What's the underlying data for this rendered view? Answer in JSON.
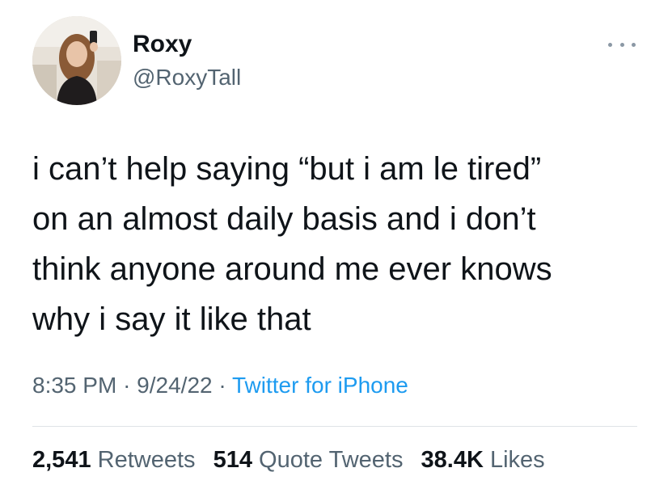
{
  "tweet": {
    "author": {
      "name": "Roxy",
      "handle": "@RoxyTall",
      "avatar_icon": "profile-photo"
    },
    "more_icon": "more-dots-icon",
    "text_lines": [
      "i can’t help saying “but i am le tired”",
      "on an almost daily basis and i don’t",
      "think anyone around me ever knows",
      "why i say it like that"
    ],
    "time": "8:35 PM",
    "date": "9/24/22",
    "separator": "·",
    "source": "Twitter for iPhone",
    "stats": {
      "retweets_count": "2,541",
      "retweets_label": "Retweets",
      "quotes_count": "514",
      "quotes_label": "Quote Tweets",
      "likes_count": "38.4K",
      "likes_label": "Likes"
    },
    "colors": {
      "text": "#0f1419",
      "secondary": "#536471",
      "link": "#1d9bf0",
      "divider": "#dfe3e6"
    }
  }
}
